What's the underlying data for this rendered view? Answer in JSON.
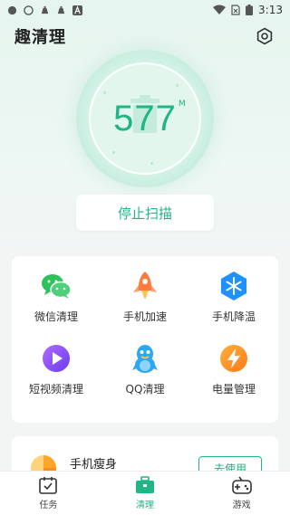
{
  "status_bar": {
    "time": "3:13",
    "icons": [
      "record-icon",
      "compass-icon",
      "notification-icon",
      "notification-icon",
      "app-a-icon",
      "wifi-icon",
      "no-sim-icon",
      "battery-icon"
    ]
  },
  "header": {
    "title": "趣清理",
    "settings_icon": "hexagon-settings-icon"
  },
  "gauge": {
    "value": "577",
    "unit": "M",
    "icon": "trash-bin-icon"
  },
  "stop_button": {
    "label": "停止扫描"
  },
  "tools": [
    {
      "label": "微信清理",
      "icon": "wechat-icon",
      "color": "#2fc25b"
    },
    {
      "label": "手机加速",
      "icon": "rocket-icon",
      "color": "#ff7a3d"
    },
    {
      "label": "手机降温",
      "icon": "snowflake-icon",
      "color": "#1e90ff"
    },
    {
      "label": "短视频清理",
      "icon": "play-icon",
      "color": "#8a4dff"
    },
    {
      "label": "QQ清理",
      "icon": "qq-penguin-icon",
      "color": "#2aa8f2"
    },
    {
      "label": "电量管理",
      "icon": "lightning-icon",
      "color": "#ff9a1f"
    }
  ],
  "promo": {
    "title": "手机瘦身",
    "button_label": "去使用",
    "icon": "pie-chart-icon"
  },
  "bottom_nav": [
    {
      "label": "任务",
      "icon": "calendar-check-icon",
      "active": false
    },
    {
      "label": "清理",
      "icon": "briefcase-icon",
      "active": true
    },
    {
      "label": "游戏",
      "icon": "gamepad-icon",
      "active": false
    }
  ],
  "colors": {
    "accent": "#1fb584",
    "background": "#f3f5f5"
  }
}
